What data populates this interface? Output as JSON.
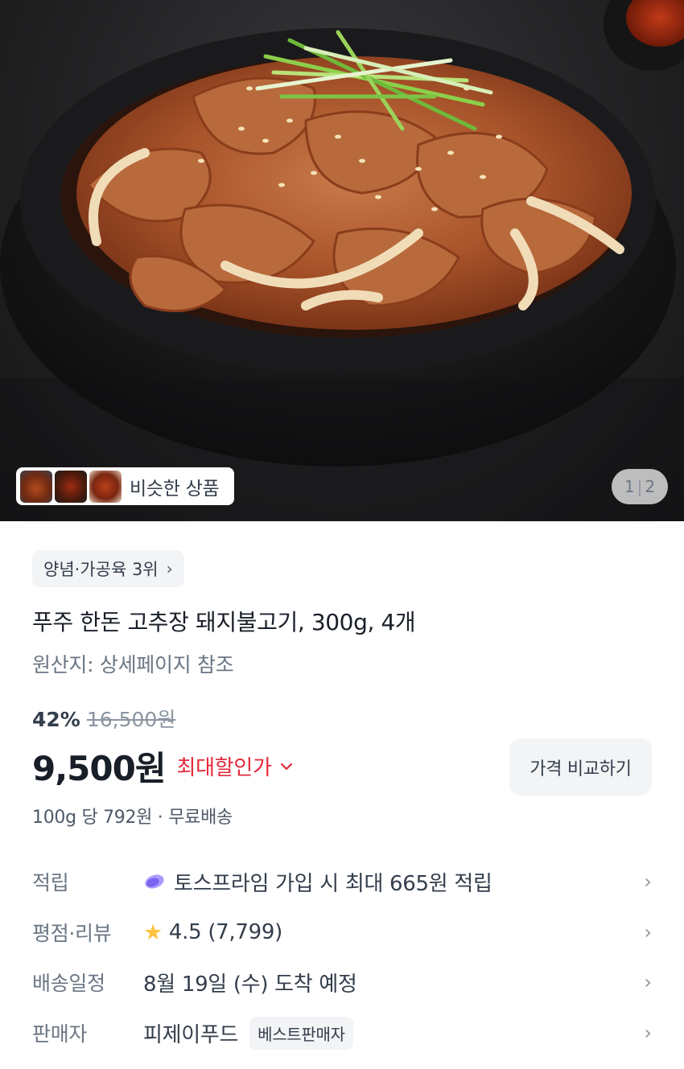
{
  "hero": {
    "image": "spicy-pork-bulgogi-photo",
    "similar_label": "비슷한 상품",
    "pager_current": "1",
    "pager_separator": "|",
    "pager_total": "2"
  },
  "product": {
    "rank_label": "양념·가공육 3위",
    "rank_chevron": "›",
    "title": "푸주 한돈 고추장 돼지불고기, 300g, 4개",
    "origin": "원산지: 상세페이지 참조",
    "discount_rate": "42%",
    "original_price": "16,500원",
    "price": "9,500원",
    "max_discount_label": "최대할인가",
    "compare_button": "가격 비교하기",
    "unit_price": "100g 당 792원 · 무료배송"
  },
  "details": {
    "rows": [
      {
        "label": "적립",
        "value": "토스프라임 가입 시 최대 665원 적립",
        "icon": "prime-icon"
      },
      {
        "label": "평점·리뷰",
        "value": "4.5 (7,799)",
        "icon": "star-icon"
      },
      {
        "label": "배송일정",
        "value": "8월 19일 (수) 도착 예정"
      },
      {
        "label": "판매자",
        "value": "피제이푸드",
        "badge": "베스트판매자"
      }
    ],
    "chevron": "›"
  },
  "colors": {
    "accent_red": "#e42939",
    "star": "#ffc342",
    "chip_bg": "#f2f4f6",
    "prime_icon": "#8e7bf5"
  }
}
